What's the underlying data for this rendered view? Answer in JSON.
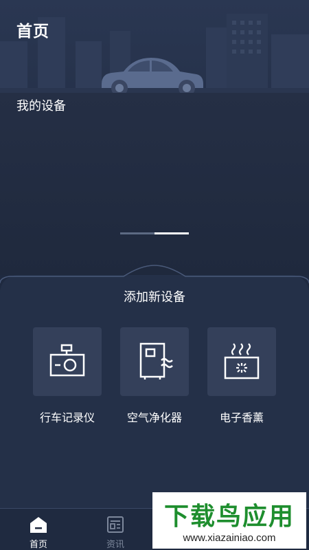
{
  "header": {
    "title": "首页"
  },
  "hero": {
    "illustration": "car-with-city-skyline"
  },
  "devices_section": {
    "title": "我的设备",
    "pager": {
      "pages": 2,
      "active": 2
    }
  },
  "add_panel": {
    "title": "添加新设备",
    "devices": [
      {
        "label": "行车记录仪",
        "icon": "dashcam-icon"
      },
      {
        "label": "空气净化器",
        "icon": "air-purifier-icon"
      },
      {
        "label": "电子香薰",
        "icon": "aroma-diffuser-icon"
      }
    ]
  },
  "tabbar": {
    "tabs": [
      {
        "label": "首页",
        "icon": "home-icon",
        "active": true
      },
      {
        "label": "资讯",
        "icon": "news-icon",
        "active": false
      }
    ]
  },
  "watermark": {
    "title": "下载鸟应用",
    "url": "www.xiazainiao.com"
  },
  "colors": {
    "background": "#1f2a40",
    "card": "#34405a",
    "active_tab": "#ffffff",
    "inactive_tab": "#7d889c",
    "watermark_green": "#1e8e2e"
  }
}
